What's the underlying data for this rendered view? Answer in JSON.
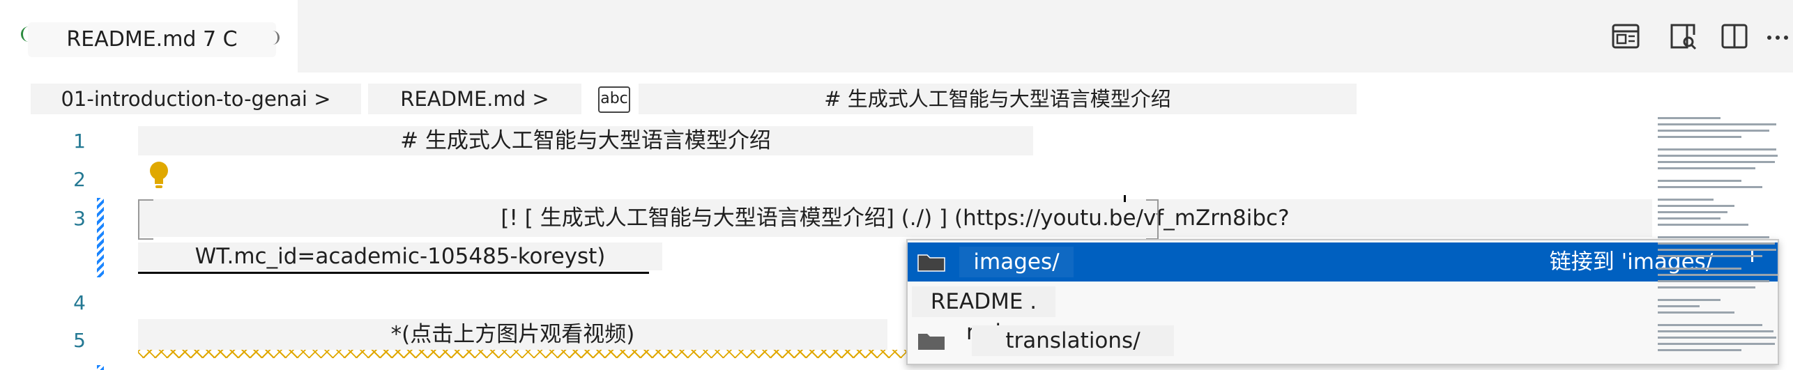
{
  "tab": {
    "label": "README.md 7 C"
  },
  "actions": [
    "open-preview-icon",
    "open-preview-side-icon",
    "split-editor-icon",
    "more-actions-icon"
  ],
  "breadcrumb": {
    "folder": "01-introduction-to-genai >",
    "file": "README.md >",
    "symbol_icon": "abc",
    "symbol": "# 生成式人工智能与大型语言模型介绍"
  },
  "lines": {
    "n1": "1",
    "n2": "2",
    "n3": "3",
    "n4": "4",
    "n5": "5",
    "l1": "# 生成式人工智能与大型语言模型介绍",
    "l3a": "[! [ 生成式人工智能与大型语言模型介绍] (./) ] (https://youtu.be/vf_mZrn8ibc?",
    "l3b": "WT.mc_id=academic-105485-koreyst)",
    "l5": "*(点击上方图片观看视频)"
  },
  "suggest": {
    "items": [
      {
        "label": "images/",
        "detail": "链接到 'images/",
        "icon": "folder-icon"
      },
      {
        "label": "README . md"
      },
      {
        "label": "translations/",
        "icon": "folder-icon"
      }
    ]
  },
  "colors": {
    "accent": "#0060c0",
    "line_number": "#237893",
    "lightbulb": "#e0a800"
  }
}
